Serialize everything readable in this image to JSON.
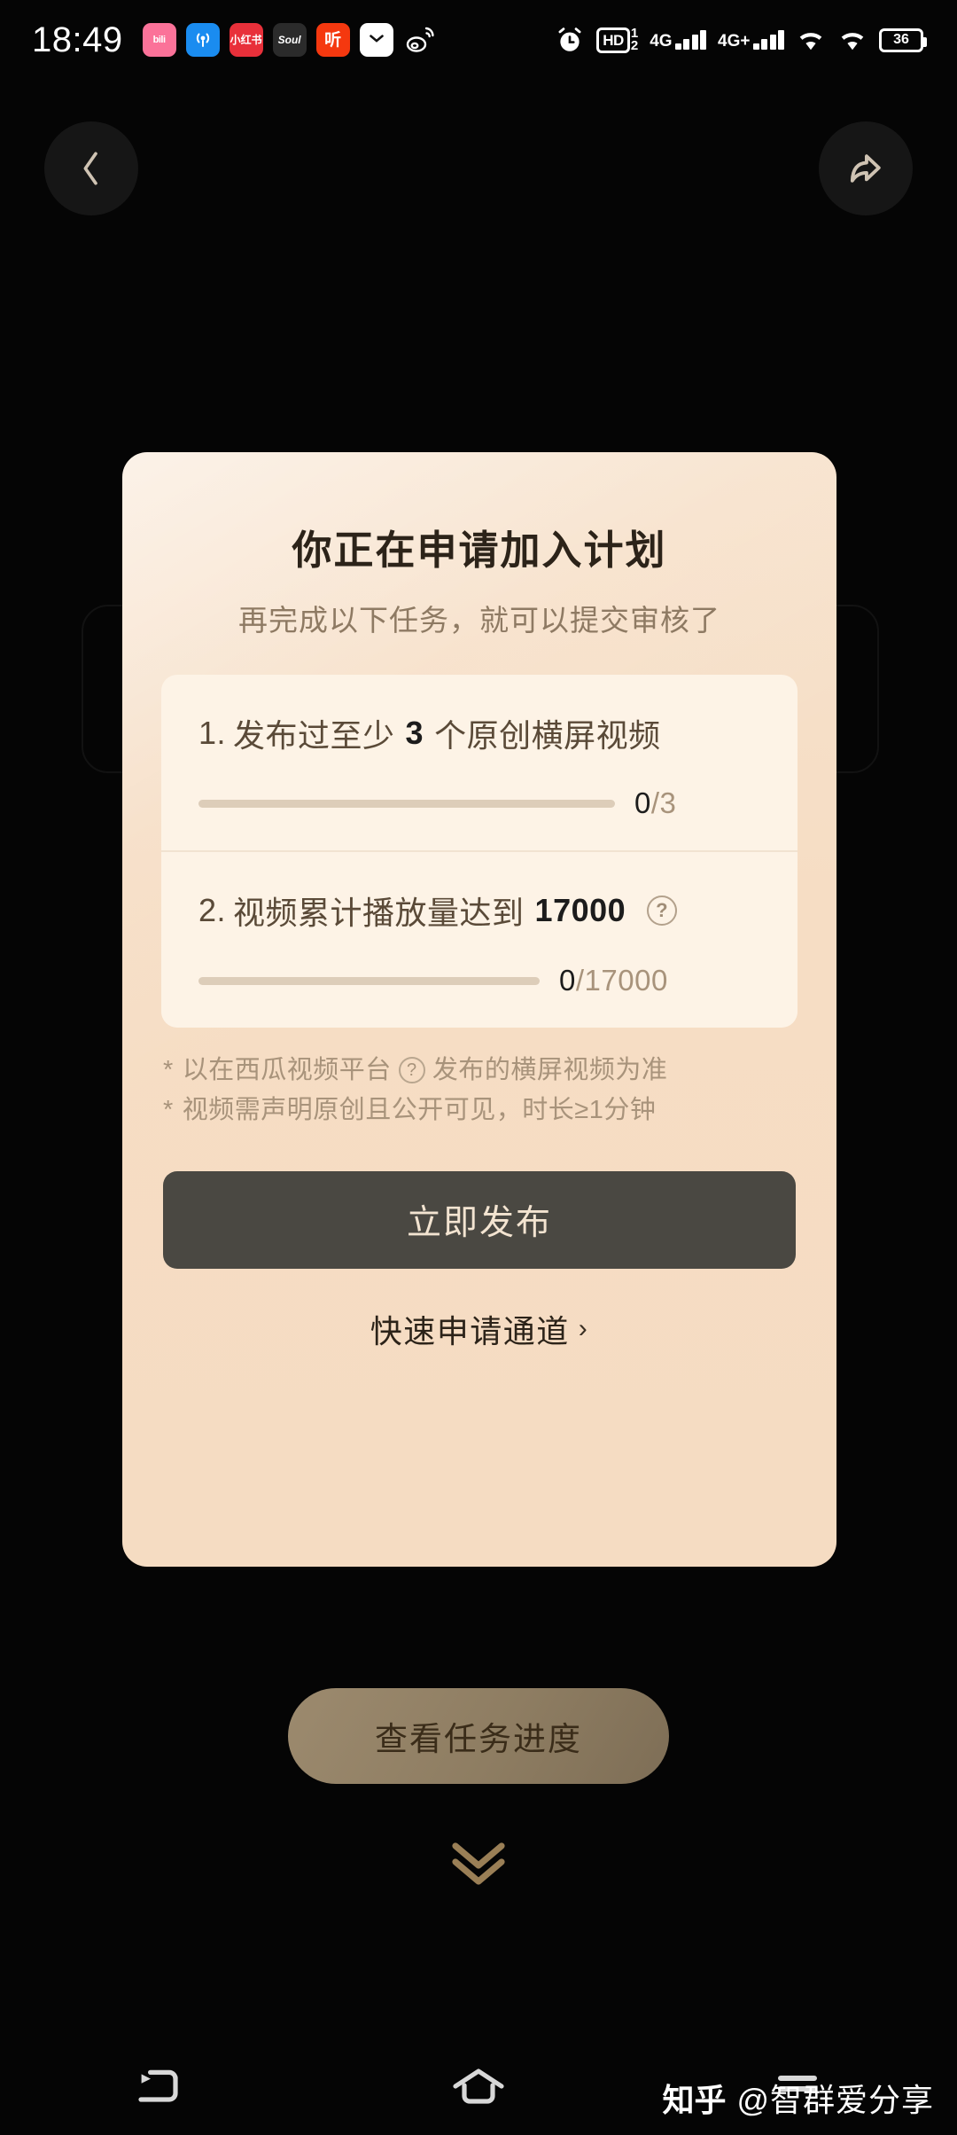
{
  "status_bar": {
    "time": "18:49",
    "app_icons": [
      {
        "name": "bilibili-icon",
        "label": "bili"
      },
      {
        "name": "podcast-icon",
        "label": "((•))"
      },
      {
        "name": "xiaohongshu-icon",
        "label": "小红书"
      },
      {
        "name": "soul-icon",
        "label": "Soul"
      },
      {
        "name": "ting-icon",
        "label": "听"
      },
      {
        "name": "mail-icon",
        "label": ""
      },
      {
        "name": "weibo-icon",
        "label": ""
      }
    ],
    "alarm_icon": "alarm-clock-icon",
    "hd_label": "HD",
    "hd_sup": "1",
    "hd_sub": "2",
    "network_1": "4G",
    "network_2": "4G+",
    "wifi_icon": "wifi-icon",
    "battery_level": "36"
  },
  "top_nav": {
    "back_label": "back-chevron",
    "share_label": "share-arrow"
  },
  "dialog": {
    "title": "你正在申请加入计划",
    "subtitle": "再完成以下任务，就可以提交审核了",
    "close_label": "✕",
    "tasks": [
      {
        "index": "1.",
        "text_before": "发布过至少",
        "target": "3",
        "text_after": "个原创横屏视频",
        "has_help": false,
        "help_label": "",
        "current": "0",
        "separator": "/",
        "total": "3",
        "progress_percent": 0
      },
      {
        "index": "2.",
        "text_before": "视频累计播放量达到",
        "target": "17000",
        "text_after": "",
        "has_help": true,
        "help_label": "?",
        "current": "0",
        "separator": "/",
        "total": "17000",
        "progress_percent": 0
      }
    ],
    "notes": [
      {
        "star": "*",
        "part1": "以在西瓜视频平台",
        "help_label": "?",
        "part2": "发布的横屏视频为准"
      },
      {
        "star": "*",
        "part1": "视频需声明原创且公开可见，时长≥1分钟",
        "help_label": "",
        "part2": ""
      }
    ],
    "cta_label": "立即发布",
    "quick_link_label": "快速申请通道",
    "quick_link_chevron": "›"
  },
  "page": {
    "progress_pill_label": "查看任务进度",
    "scroll_hint_icon": "double-chevron-down-icon"
  },
  "nav_bar": {
    "back_icon": "back-arrow-icon",
    "home_icon": "home-icon",
    "recents_icon": "recents-icon"
  },
  "watermark": {
    "brand": "知乎",
    "handle": "@智群爱分享"
  },
  "colors": {
    "dialog_bg": "#f5dcc2",
    "task_card_bg": "#fdf3e6",
    "cta_bg": "#4a4842",
    "cta_text": "#f3e4d1",
    "accent_text": "#a8937b",
    "title_text": "#2c2319",
    "pill_bg": "#8e7d62"
  }
}
